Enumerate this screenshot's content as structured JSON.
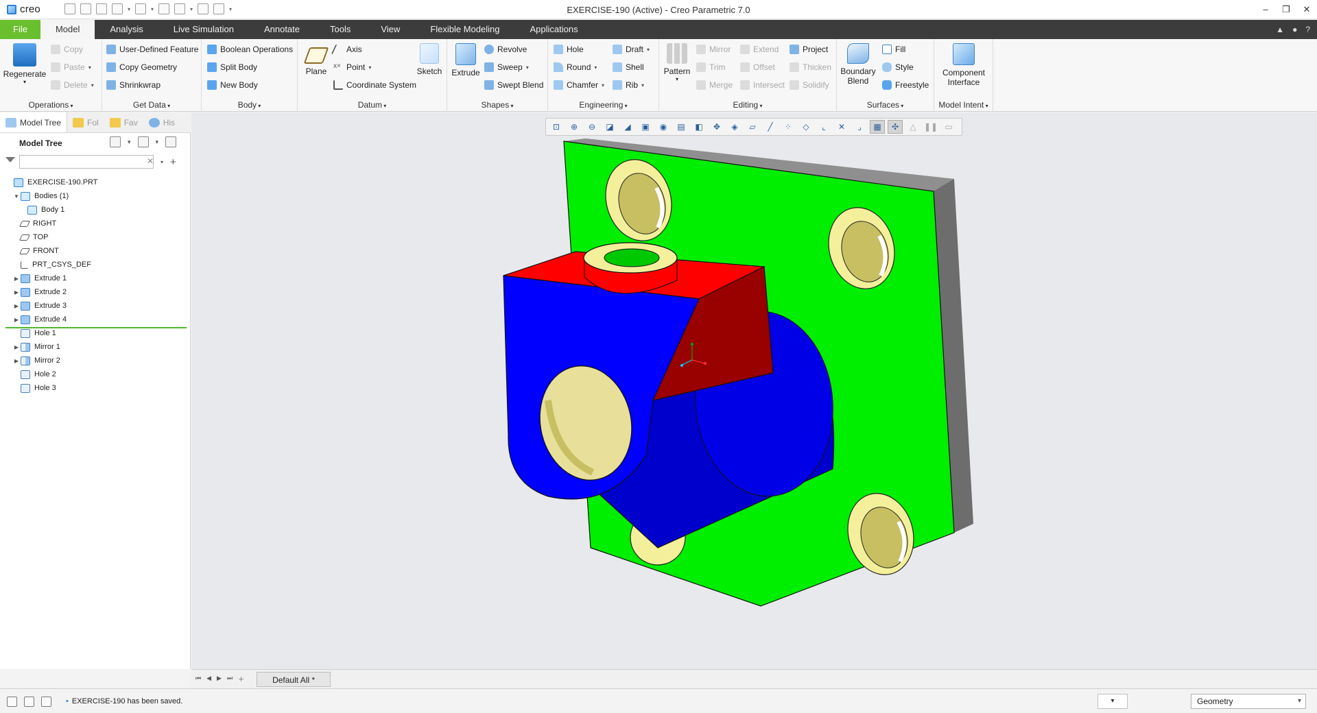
{
  "window": {
    "app_name": "creo",
    "title": "EXERCISE-190 (Active) - Creo Parametric 7.0",
    "controls": [
      "–",
      "❐",
      "✕"
    ]
  },
  "tabs": [
    "File",
    "Model",
    "Analysis",
    "Live Simulation",
    "Annotate",
    "Tools",
    "View",
    "Flexible Modeling",
    "Applications"
  ],
  "ribbon": {
    "operations": {
      "label": "Operations",
      "regenerate": "Regenerate",
      "copy": "Copy",
      "paste": "Paste",
      "delete": "Delete"
    },
    "get_data": {
      "label": "Get Data",
      "udf": "User-Defined Feature",
      "copy_geometry": "Copy Geometry",
      "shrinkwrap": "Shrinkwrap"
    },
    "body": {
      "label": "Body",
      "boolean": "Boolean Operations",
      "split": "Split Body",
      "new": "New Body"
    },
    "datum": {
      "label": "Datum",
      "plane": "Plane",
      "axis": "Axis",
      "point": "Point",
      "csys": "Coordinate System",
      "sketch": "Sketch"
    },
    "shapes": {
      "label": "Shapes",
      "extrude": "Extrude",
      "revolve": "Revolve",
      "sweep": "Sweep",
      "swept_blend": "Swept Blend"
    },
    "engineering": {
      "label": "Engineering",
      "hole": "Hole",
      "round": "Round",
      "chamfer": "Chamfer",
      "draft": "Draft",
      "shell": "Shell",
      "rib": "Rib"
    },
    "editing": {
      "label": "Editing",
      "pattern": "Pattern",
      "mirror": "Mirror",
      "trim": "Trim",
      "merge": "Merge",
      "extend": "Extend",
      "offset": "Offset",
      "intersect": "Intersect",
      "project": "Project",
      "thicken": "Thicken",
      "solidify": "Solidify"
    },
    "surfaces": {
      "label": "Surfaces",
      "boundary_blend_1": "Boundary",
      "boundary_blend_2": "Blend",
      "fill": "Fill",
      "style": "Style",
      "freestyle": "Freestyle"
    },
    "model_intent": {
      "label": "Model Intent",
      "component_interface_1": "Component",
      "component_interface_2": "Interface"
    }
  },
  "left_tabs": [
    "Model Tree",
    "Fol",
    "Fav",
    "His"
  ],
  "model_tree": {
    "title": "Model Tree",
    "search_placeholder": "",
    "items": [
      {
        "label": "EXERCISE-190.PRT",
        "icon": "part-icon",
        "indent": 0,
        "toggle": ""
      },
      {
        "label": "Bodies (1)",
        "icon": "bodies-icon",
        "indent": 1,
        "toggle": "▼"
      },
      {
        "label": "Body 1",
        "icon": "body-icon",
        "indent": 2,
        "toggle": ""
      },
      {
        "label": "RIGHT",
        "icon": "datum-plane-icon",
        "indent": 1,
        "toggle": ""
      },
      {
        "label": "TOP",
        "icon": "datum-plane-icon",
        "indent": 1,
        "toggle": ""
      },
      {
        "label": "FRONT",
        "icon": "datum-plane-icon",
        "indent": 1,
        "toggle": ""
      },
      {
        "label": "PRT_CSYS_DEF",
        "icon": "csys-icon",
        "indent": 1,
        "toggle": ""
      },
      {
        "label": "Extrude 1",
        "icon": "extrude-icon",
        "indent": 1,
        "toggle": "▶"
      },
      {
        "label": "Extrude 2",
        "icon": "extrude-icon",
        "indent": 1,
        "toggle": "▶"
      },
      {
        "label": "Extrude 3",
        "icon": "extrude-icon",
        "indent": 1,
        "toggle": "▶"
      },
      {
        "label": "Extrude 4",
        "icon": "extrude-icon",
        "indent": 1,
        "toggle": "▶"
      },
      {
        "label": "Hole 1",
        "icon": "hole-icon",
        "indent": 1,
        "toggle": ""
      },
      {
        "label": "Mirror 1",
        "icon": "mirror-icon",
        "indent": 1,
        "toggle": "▶"
      },
      {
        "label": "Mirror 2",
        "icon": "mirror-icon",
        "indent": 1,
        "toggle": "▶"
      },
      {
        "label": "Hole 2",
        "icon": "hole-icon",
        "indent": 1,
        "toggle": ""
      },
      {
        "label": "Hole 3",
        "icon": "hole-icon",
        "indent": 1,
        "toggle": ""
      }
    ]
  },
  "bottom_tab": "Default All *",
  "status": {
    "message": "EXERCISE-190 has been saved.",
    "filter_value": "Geometry"
  },
  "colors": {
    "accent_file_tab": "#6abf2e",
    "plate_face": "#00ee00",
    "block_blue": "#0000ff",
    "block_red": "#ff0000",
    "hole_surface": "#e8e09a"
  }
}
